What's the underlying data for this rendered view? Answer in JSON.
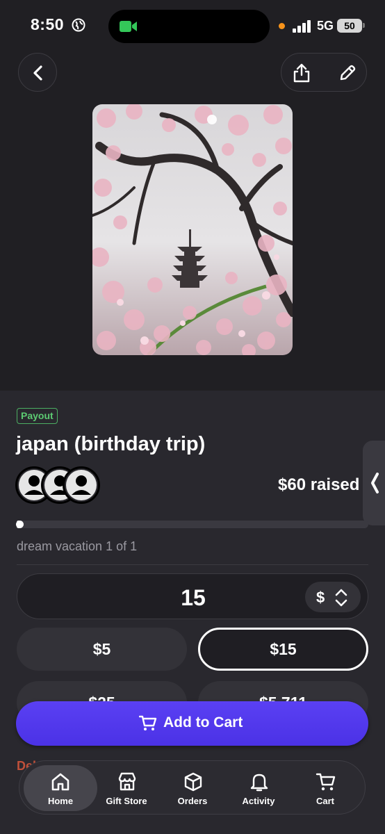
{
  "status_bar": {
    "time": "8:50",
    "network": "5G",
    "battery": "50"
  },
  "item": {
    "badge": "Payout",
    "title": "japan (birthday trip)",
    "raised": "$60 raised",
    "progress": 0.01,
    "subtitle": "dream vacation 1 of 1"
  },
  "amount": {
    "value": "15",
    "currency": "$"
  },
  "presets": [
    "$5",
    "$15",
    "$25",
    "$5,711"
  ],
  "selected_preset": "$15",
  "cart_button": {
    "label": "Add to Cart"
  },
  "peek_text": "Del",
  "tabs": [
    {
      "label": "Home",
      "icon": "home-icon",
      "active": true
    },
    {
      "label": "Gift Store",
      "icon": "store-icon",
      "active": false
    },
    {
      "label": "Orders",
      "icon": "box-icon",
      "active": false
    },
    {
      "label": "Activity",
      "icon": "bell-icon",
      "active": false
    },
    {
      "label": "Cart",
      "icon": "cart-icon",
      "active": false
    }
  ],
  "colors": {
    "accent": "#5a40f3",
    "payout_green": "#5ccb72",
    "background": "#201f23"
  }
}
